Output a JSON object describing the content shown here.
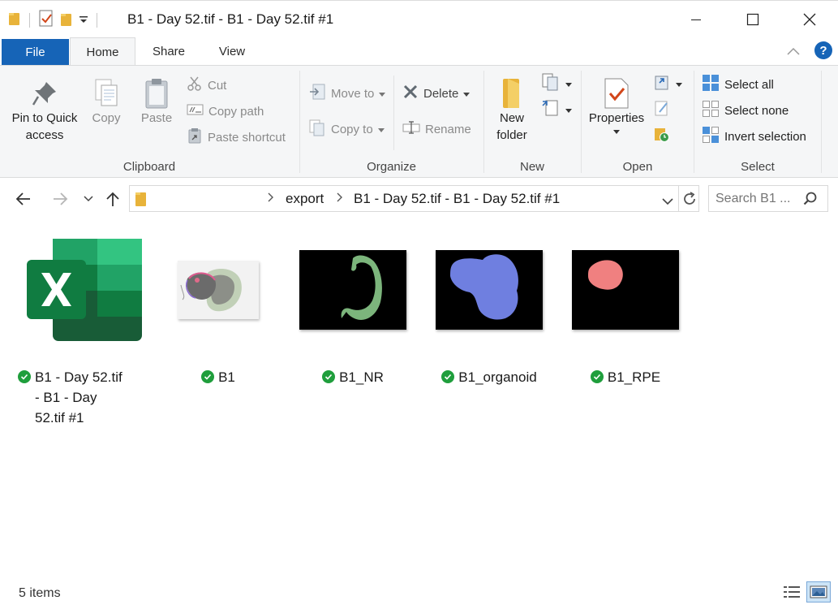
{
  "window": {
    "title": "B1 - Day 52.tif - B1 - Day 52.tif #1"
  },
  "tabs": {
    "file": "File",
    "home": "Home",
    "share": "Share",
    "view": "View"
  },
  "ribbon": {
    "clipboard": {
      "pin_line1": "Pin to Quick",
      "pin_line2": "access",
      "copy": "Copy",
      "paste": "Paste",
      "cut": "Cut",
      "copy_path": "Copy path",
      "paste_shortcut": "Paste shortcut",
      "label": "Clipboard"
    },
    "organize": {
      "move_to": "Move to",
      "copy_to": "Copy to",
      "delete": "Delete",
      "rename": "Rename",
      "label": "Organize"
    },
    "new": {
      "new_folder_line1": "New",
      "new_folder_line2": "folder",
      "label": "New"
    },
    "open": {
      "properties": "Properties",
      "label": "Open"
    },
    "select": {
      "select_all": "Select all",
      "select_none": "Select none",
      "invert_selection": "Invert selection",
      "label": "Select"
    }
  },
  "address": {
    "crumbs": [
      "export",
      "B1 - Day 52.tif - B1 - Day 52.tif #1"
    ],
    "search_placeholder": "Search B1 ..."
  },
  "files": [
    {
      "name_lines": [
        "B1 - Day 52.tif",
        "- B1 - Day",
        "52.tif #1"
      ],
      "type": "excel-icon"
    },
    {
      "name": "B1",
      "type": "image-thumbnail"
    },
    {
      "name": "B1_NR",
      "type": "image-thumbnail"
    },
    {
      "name": "B1_organoid",
      "type": "image-thumbnail"
    },
    {
      "name": "B1_RPE",
      "type": "image-thumbnail"
    }
  ],
  "status": {
    "item_count": "5 items"
  },
  "colors": {
    "file_tab": "#1664b7",
    "sync_check": "#1f9e3c",
    "excel_green": "#1d6f42",
    "nr_mask": "#7cb57c",
    "organoid_mask": "#6f7fe0",
    "rpe_mask": "#f08080"
  }
}
